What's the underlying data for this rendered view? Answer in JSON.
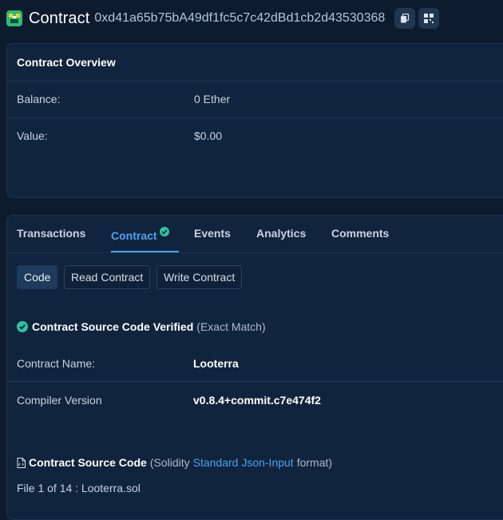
{
  "header": {
    "title": "Contract",
    "address": "0xd41a65b75bA49df1fc5c7c42dBd1cb2d43530368",
    "icons": [
      "contract-logo-icon",
      "copy-icon",
      "qr-code-icon"
    ]
  },
  "overview": {
    "title": "Contract Overview",
    "balance_label": "Balance:",
    "balance_value": "0 Ether",
    "value_label": "Value:",
    "value_value": "$0.00"
  },
  "tabs": [
    {
      "label": "Transactions"
    },
    {
      "label": "Contract",
      "active": true
    },
    {
      "label": "Events"
    },
    {
      "label": "Analytics"
    },
    {
      "label": "Comments"
    }
  ],
  "subtabs": [
    {
      "label": "Code",
      "active": true
    },
    {
      "label": "Read Contract"
    },
    {
      "label": "Write Contract"
    }
  ],
  "verification": {
    "title": "Contract Source Code Verified",
    "note": "(Exact Match)"
  },
  "details": {
    "name_label": "Contract Name:",
    "name_value": "Looterra",
    "compiler_label": "Compiler Version",
    "compiler_value": "v0.8.4+commit.c7e474f2"
  },
  "source": {
    "title": "Contract Source Code",
    "prefix": "(Solidity",
    "link": "Standard Json-Input",
    "suffix": "format)",
    "file_info": "File 1 of 14 : Looterra.sol"
  },
  "colors": {
    "background": "#0d1b2e",
    "card": "#11243d",
    "accent": "#4aa3ef",
    "verified": "#2ec3a3"
  }
}
